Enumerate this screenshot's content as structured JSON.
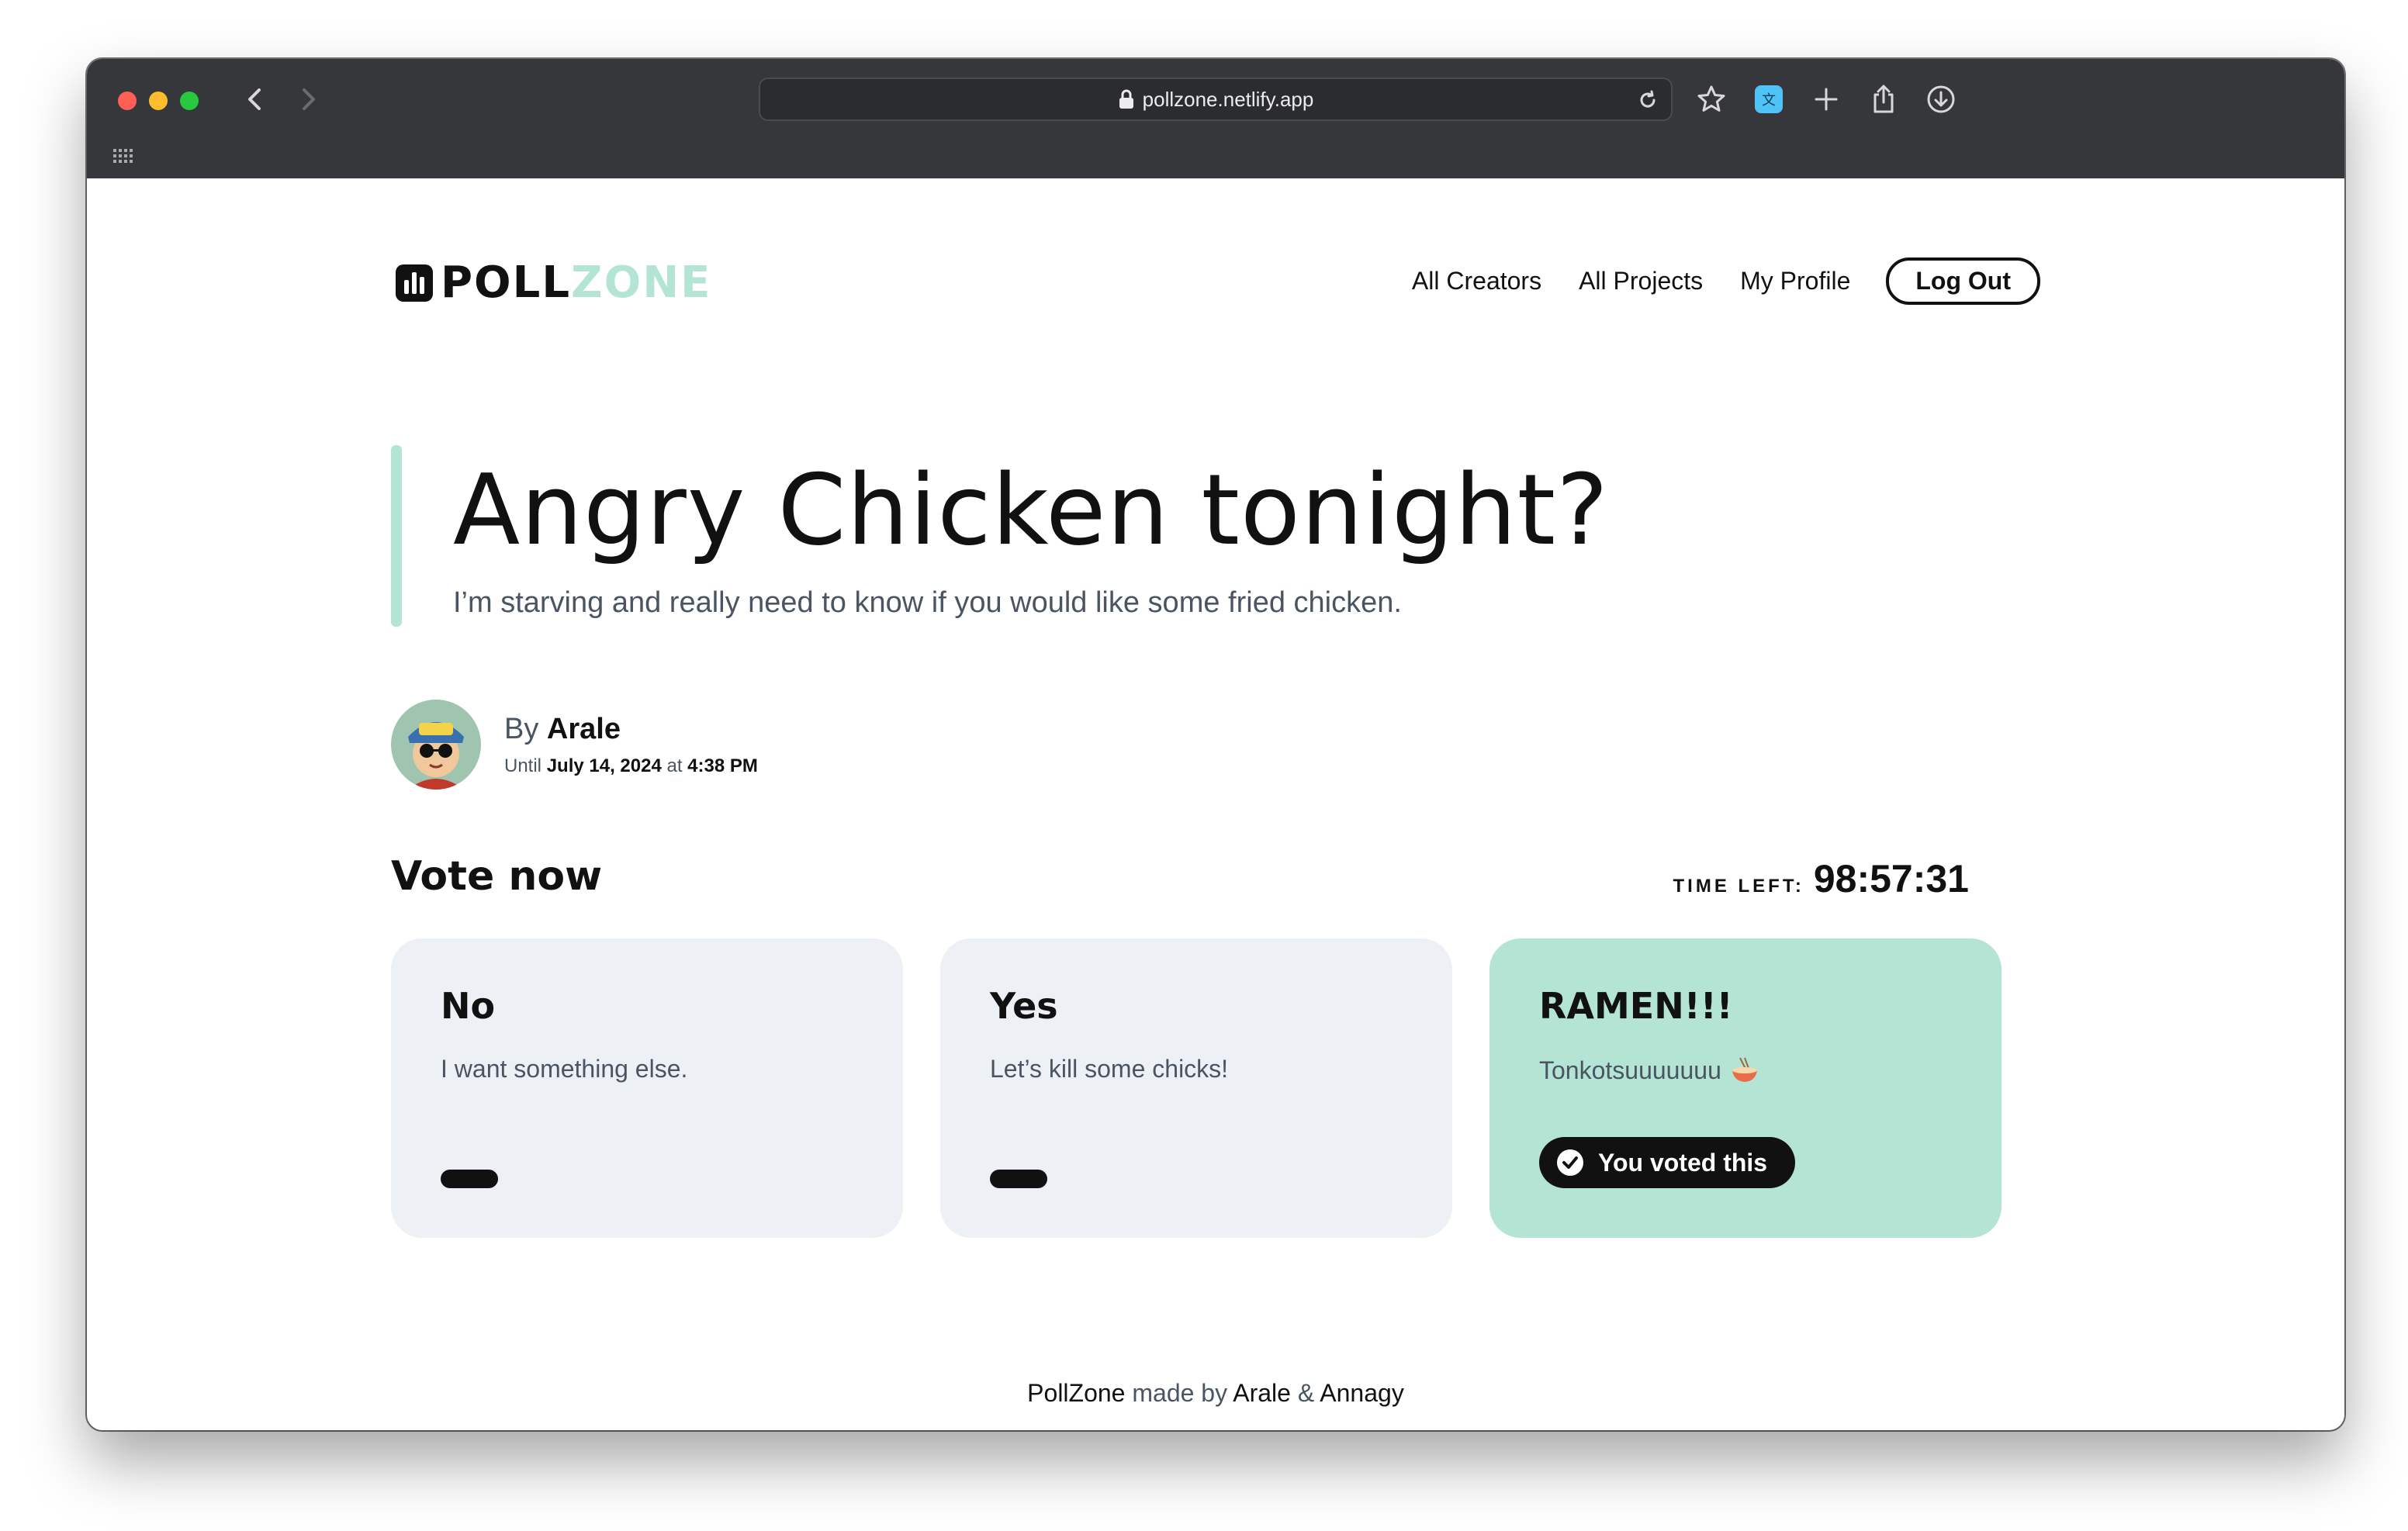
{
  "browser": {
    "url": "pollzone.netlify.app"
  },
  "header": {
    "logo_part1": "POLL",
    "logo_part2": "ZONE",
    "nav": [
      "All Creators",
      "All Projects",
      "My Profile"
    ],
    "logout_label": "Log Out"
  },
  "poll": {
    "title": "Angry Chicken tonight?",
    "subtitle": "I’m starving and really need to know if you would like some fried chicken.",
    "author_prefix": "By",
    "author_name": "Arale",
    "until_label": "Until",
    "until_date": "July 14, 2024",
    "at_label": "at",
    "until_time": "4:38 PM"
  },
  "vote": {
    "heading": "Vote now",
    "time_left_label": "TIME LEFT:",
    "time_left_value": "98:57:31",
    "options": [
      {
        "title": "No",
        "description": "I want something else.",
        "voted": false
      },
      {
        "title": "Yes",
        "description": "Let’s kill some chicks!",
        "voted": false
      },
      {
        "title": "RAMEN!!!",
        "description": "Tonkotsuuuuuuu",
        "voted": true,
        "voted_label": "You voted this"
      }
    ]
  },
  "footer": {
    "app": "PollZone",
    "made_by": "made by",
    "author1": "Arale",
    "amp": "&",
    "author2": "Annagy"
  },
  "colors": {
    "accent": "#b4e4d4",
    "card_bg": "#edf0f5",
    "text_dark": "#111111",
    "text_muted": "#4a5563"
  }
}
